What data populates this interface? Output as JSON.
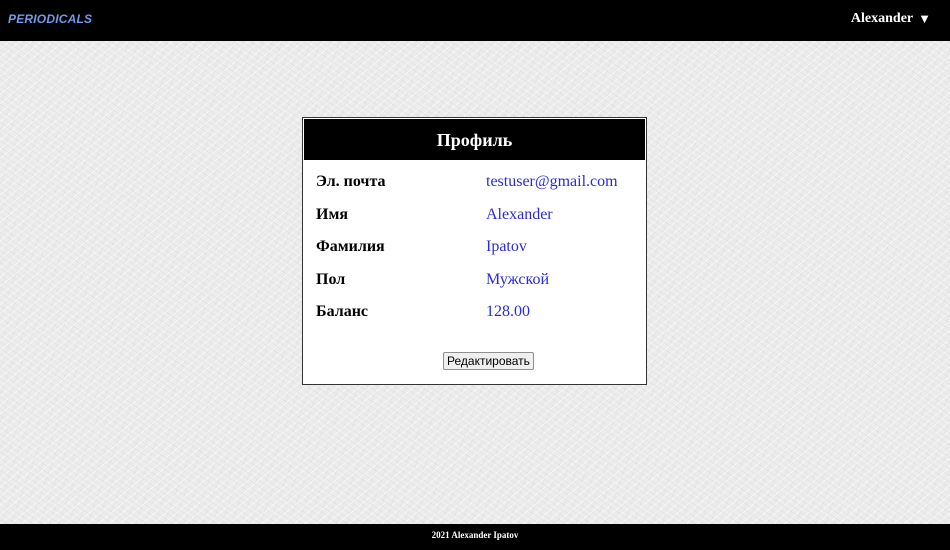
{
  "header": {
    "brand": "PERIODICALS",
    "user_name": "Alexander",
    "user_caret": "▼"
  },
  "profile": {
    "title": "Профиль",
    "fields": [
      {
        "label": "Эл. почта",
        "value": "testuser@gmail.com"
      },
      {
        "label": "Имя",
        "value": "Alexander"
      },
      {
        "label": "Фамилия",
        "value": "Ipatov"
      },
      {
        "label": "Пол",
        "value": "Мужской"
      },
      {
        "label": "Баланс",
        "value": "128.00"
      }
    ],
    "edit_label": "Редактировать"
  },
  "footer": {
    "text": "2021 Alexander Ipatov"
  },
  "colors": {
    "brand": "#6f9bea",
    "value_text": "#2b2bd6",
    "bar_background": "#000000"
  }
}
